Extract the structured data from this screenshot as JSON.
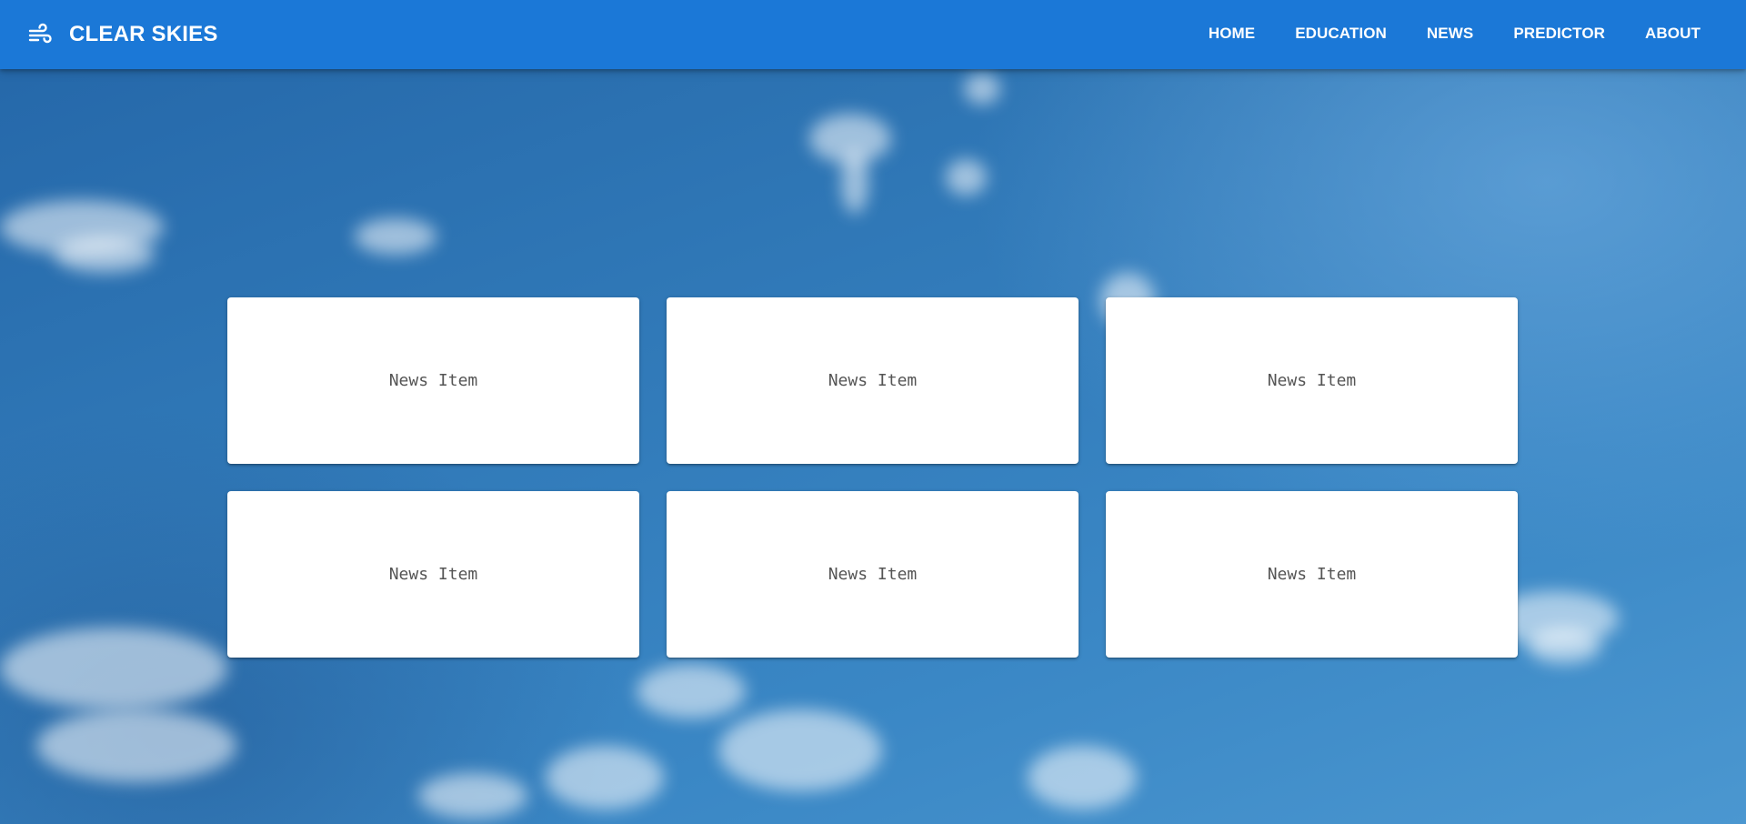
{
  "brand": {
    "icon": "wind-icon",
    "title": "CLEAR SKIES"
  },
  "nav": {
    "items": [
      {
        "label": "HOME"
      },
      {
        "label": "EDUCATION"
      },
      {
        "label": "NEWS"
      },
      {
        "label": "PREDICTOR"
      },
      {
        "label": "ABOUT"
      }
    ]
  },
  "news": {
    "items": [
      {
        "text": "News Item"
      },
      {
        "text": "News Item"
      },
      {
        "text": "News Item"
      },
      {
        "text": "News Item"
      },
      {
        "text": "News Item"
      },
      {
        "text": "News Item"
      }
    ]
  },
  "colors": {
    "appbar": "#1b78d7",
    "sky": "#2f77b6",
    "card": "#ffffff",
    "card_text": "#555555"
  }
}
